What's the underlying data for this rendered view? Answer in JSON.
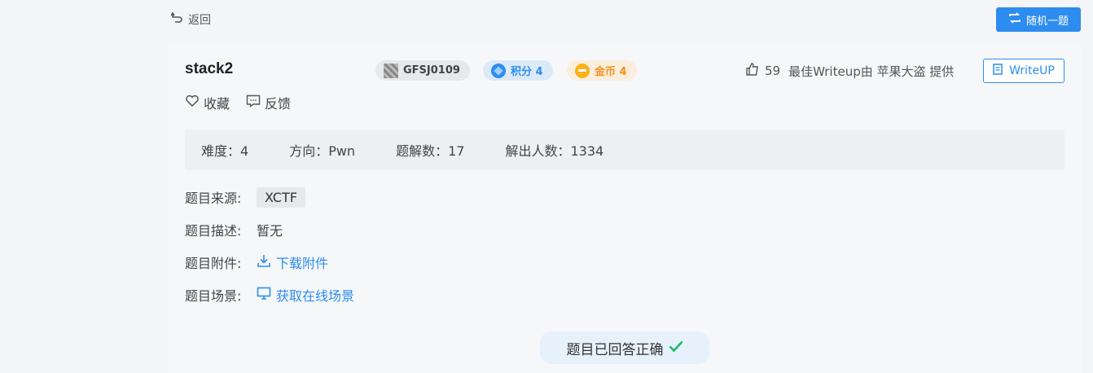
{
  "nav": {
    "back_label": "返回",
    "random_label": "随机一题"
  },
  "challenge": {
    "title": "stack2",
    "id_badge": "GFSJ0109",
    "score_badge": "积分 4",
    "coin_badge": "金币 4",
    "likes": "59",
    "writeup_credit": "最佳Writeup由 苹果大盗 提供",
    "writeup_button": "WriteUP",
    "favorite_label": "收藏",
    "feedback_label": "反馈"
  },
  "stats": {
    "difficulty": "难度：4",
    "direction": "方向：Pwn",
    "solve_count": "题解数：17",
    "solver_count": "解出人数：1334"
  },
  "details": {
    "source_label": "题目来源:",
    "source_value": "XCTF",
    "desc_label": "题目描述:",
    "desc_value": "暂无",
    "attach_label": "题目附件:",
    "attach_link": "下载附件",
    "scene_label": "题目场景:",
    "scene_link": "获取在线场景"
  },
  "status": {
    "solved_text": "题目已回答正确"
  },
  "colors": {
    "accent": "#2d8cf0",
    "coin": "#f5921e",
    "success": "#19be6b"
  }
}
